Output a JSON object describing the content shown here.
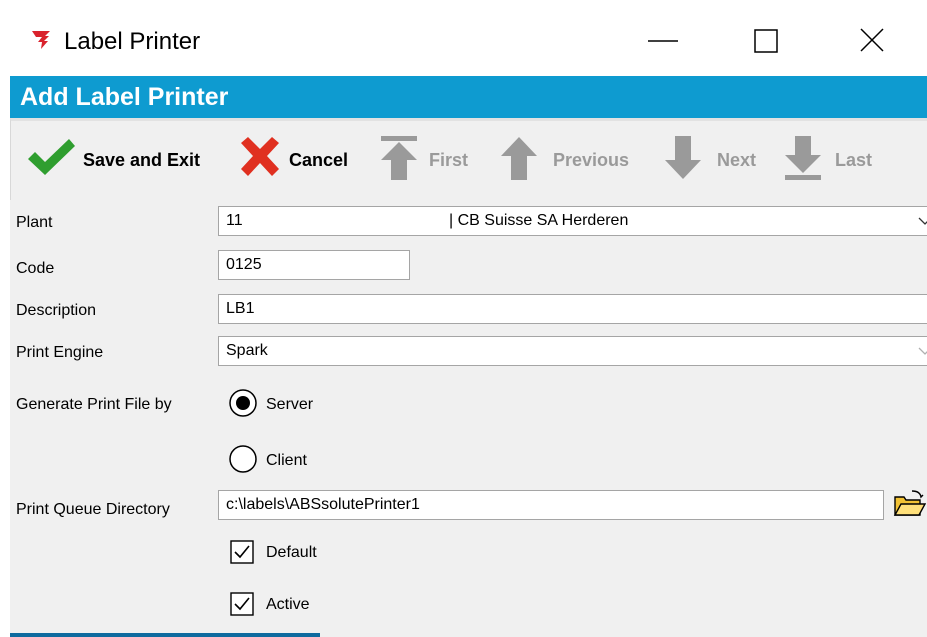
{
  "window": {
    "title": "Label Printer",
    "icons": {
      "app": "app-logo-icon",
      "minimize": "minimize-icon",
      "maximize": "maximize-icon",
      "close": "close-icon"
    }
  },
  "form": {
    "header": "Add Label Printer",
    "header_color": "#0e9bd0"
  },
  "toolbar": {
    "save_exit": "Save and Exit",
    "cancel": "Cancel",
    "first": "First",
    "previous": "Previous",
    "next": "Next",
    "last": "Last",
    "icons": {
      "save": "checkmark-icon",
      "cancel": "cross-icon",
      "first": "arrow-first-icon",
      "previous": "arrow-up-icon",
      "next": "arrow-down-icon",
      "last": "arrow-last-icon"
    }
  },
  "fields": {
    "plant_label": "Plant",
    "plant_code": "11",
    "plant_name": "| CB Suisse SA Herderen",
    "code_label": "Code",
    "code_value": "0125",
    "description_label": "Description",
    "description_value": "LB1",
    "print_engine_label": "Print Engine",
    "print_engine_value": "Spark",
    "generate_label": "Generate Print File by",
    "option_server": "Server",
    "option_client": "Client",
    "selected_option": "Server",
    "queue_label": "Print Queue Directory",
    "queue_value": "c:\\labels\\ABSsolutePrinter1",
    "default_label": "Default",
    "default_checked": true,
    "active_label": "Active",
    "active_checked": true
  }
}
